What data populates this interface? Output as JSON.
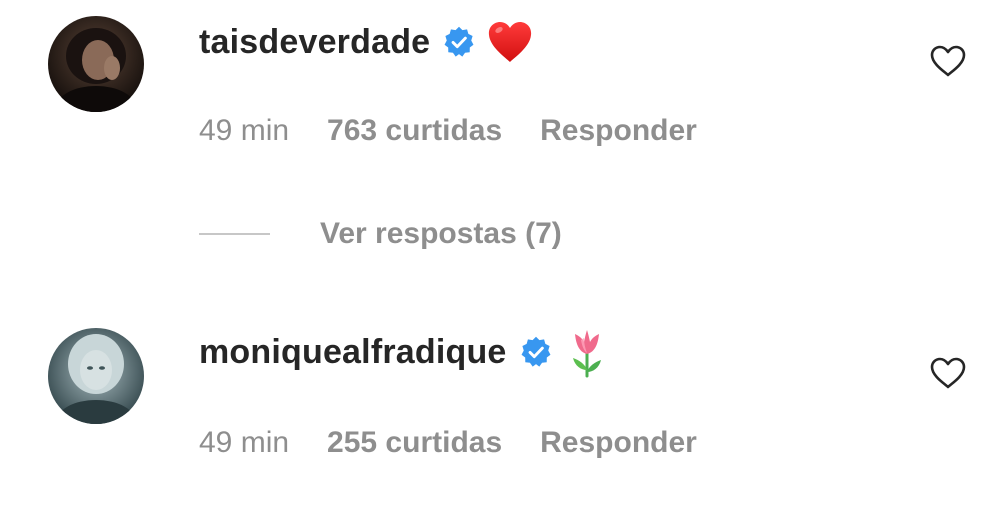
{
  "comments": [
    {
      "username": "taisdeverdade",
      "verified": true,
      "emoji_icon": "red-heart-emoji",
      "time": "49 min",
      "likes": "763 curtidas",
      "reply_label": "Responder"
    },
    {
      "username": "moniquealfradique",
      "verified": true,
      "emoji_icon": "tulip-emoji",
      "time": "49 min",
      "likes": "255 curtidas",
      "reply_label": "Responder"
    }
  ],
  "view_replies": {
    "label": "Ver respostas (7)"
  },
  "colors": {
    "username": "#262626",
    "meta": "#8e8e8e",
    "verified_badge": "#3897f0",
    "divider": "#c7c7c7"
  }
}
